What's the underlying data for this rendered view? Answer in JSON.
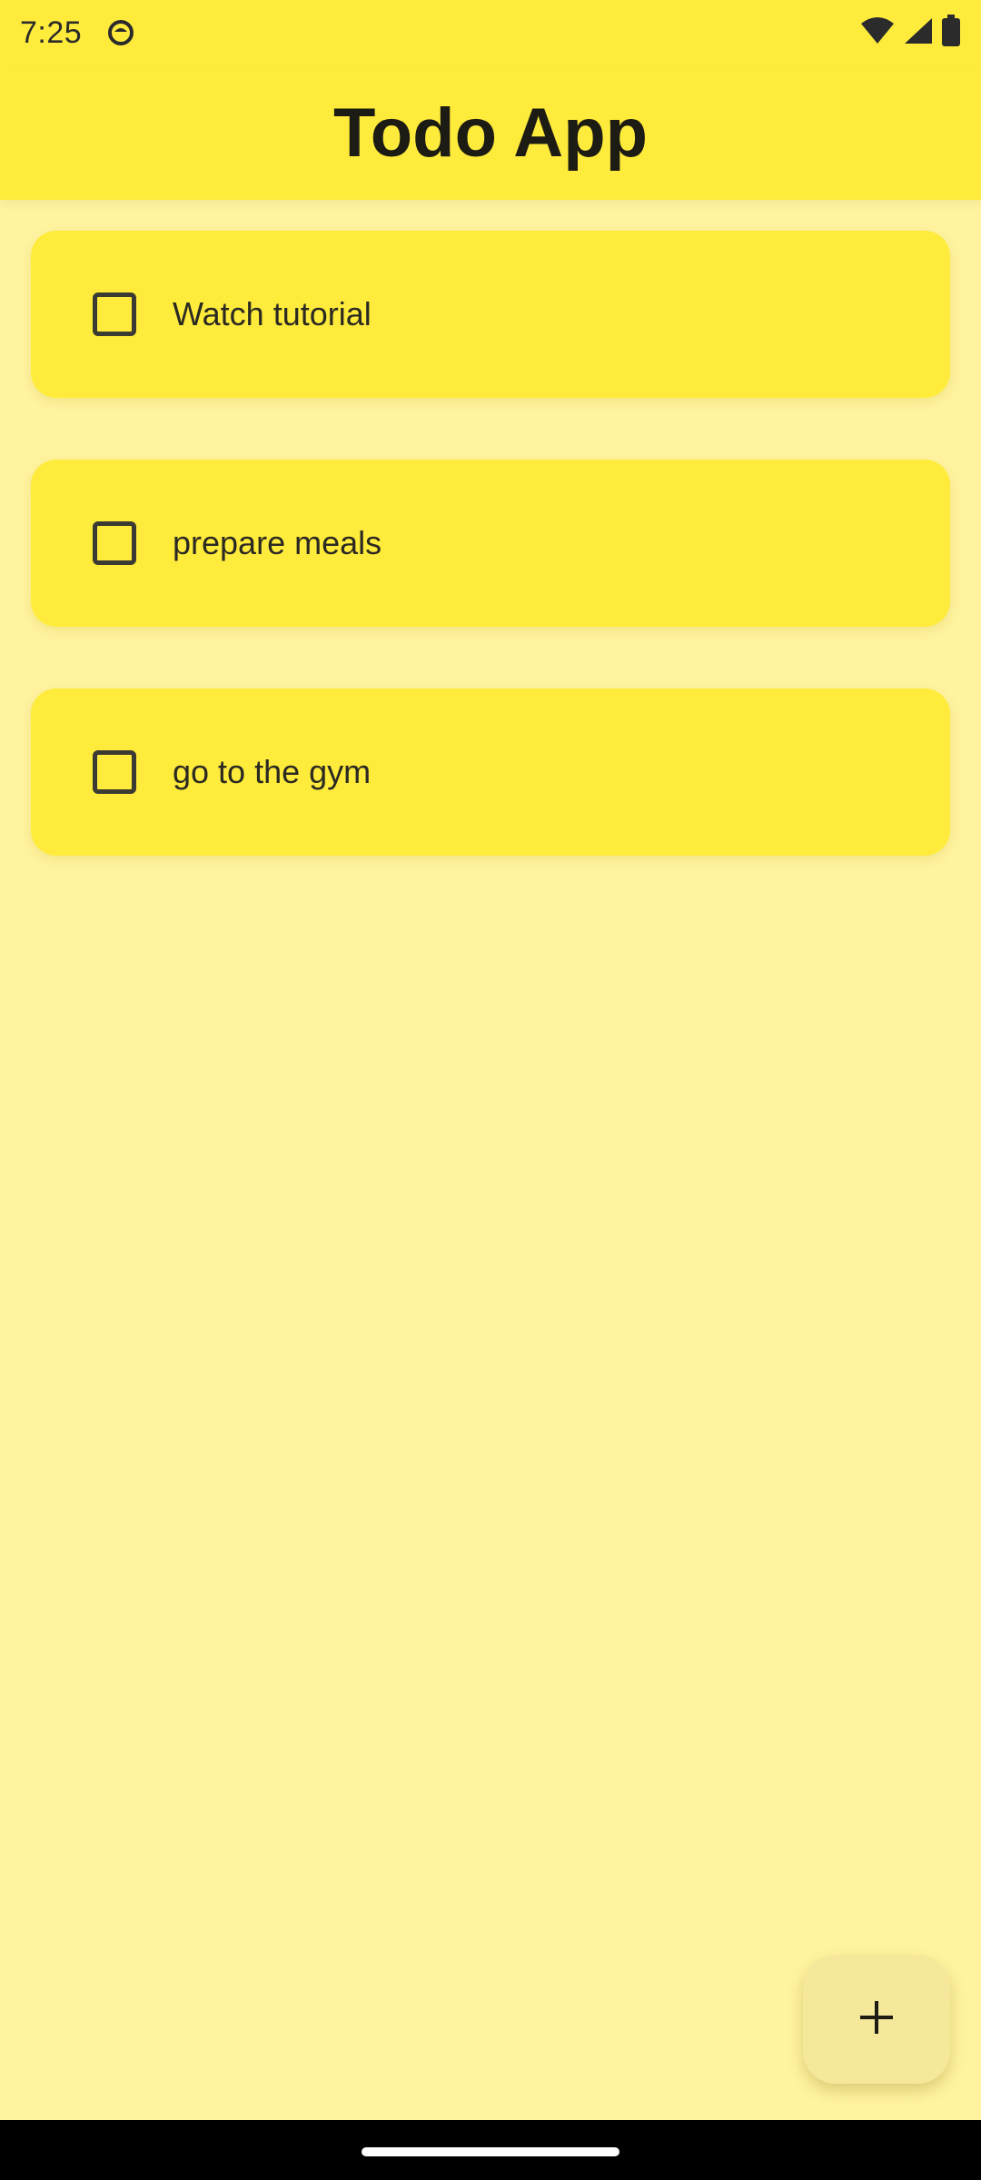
{
  "status_bar": {
    "time": "7:25",
    "icons": [
      "notification-icon",
      "wifi-icon",
      "signal-icon",
      "battery-icon"
    ]
  },
  "app_bar": {
    "title": "Todo App"
  },
  "todos": [
    {
      "label": "Watch tutorial",
      "checked": false
    },
    {
      "label": "prepare meals",
      "checked": false
    },
    {
      "label": "go to the gym",
      "checked": false
    }
  ],
  "fab": {
    "icon": "plus-icon"
  },
  "colors": {
    "accent": "#ffeb3b",
    "background": "#fff3a0",
    "text": "#2a2922"
  }
}
